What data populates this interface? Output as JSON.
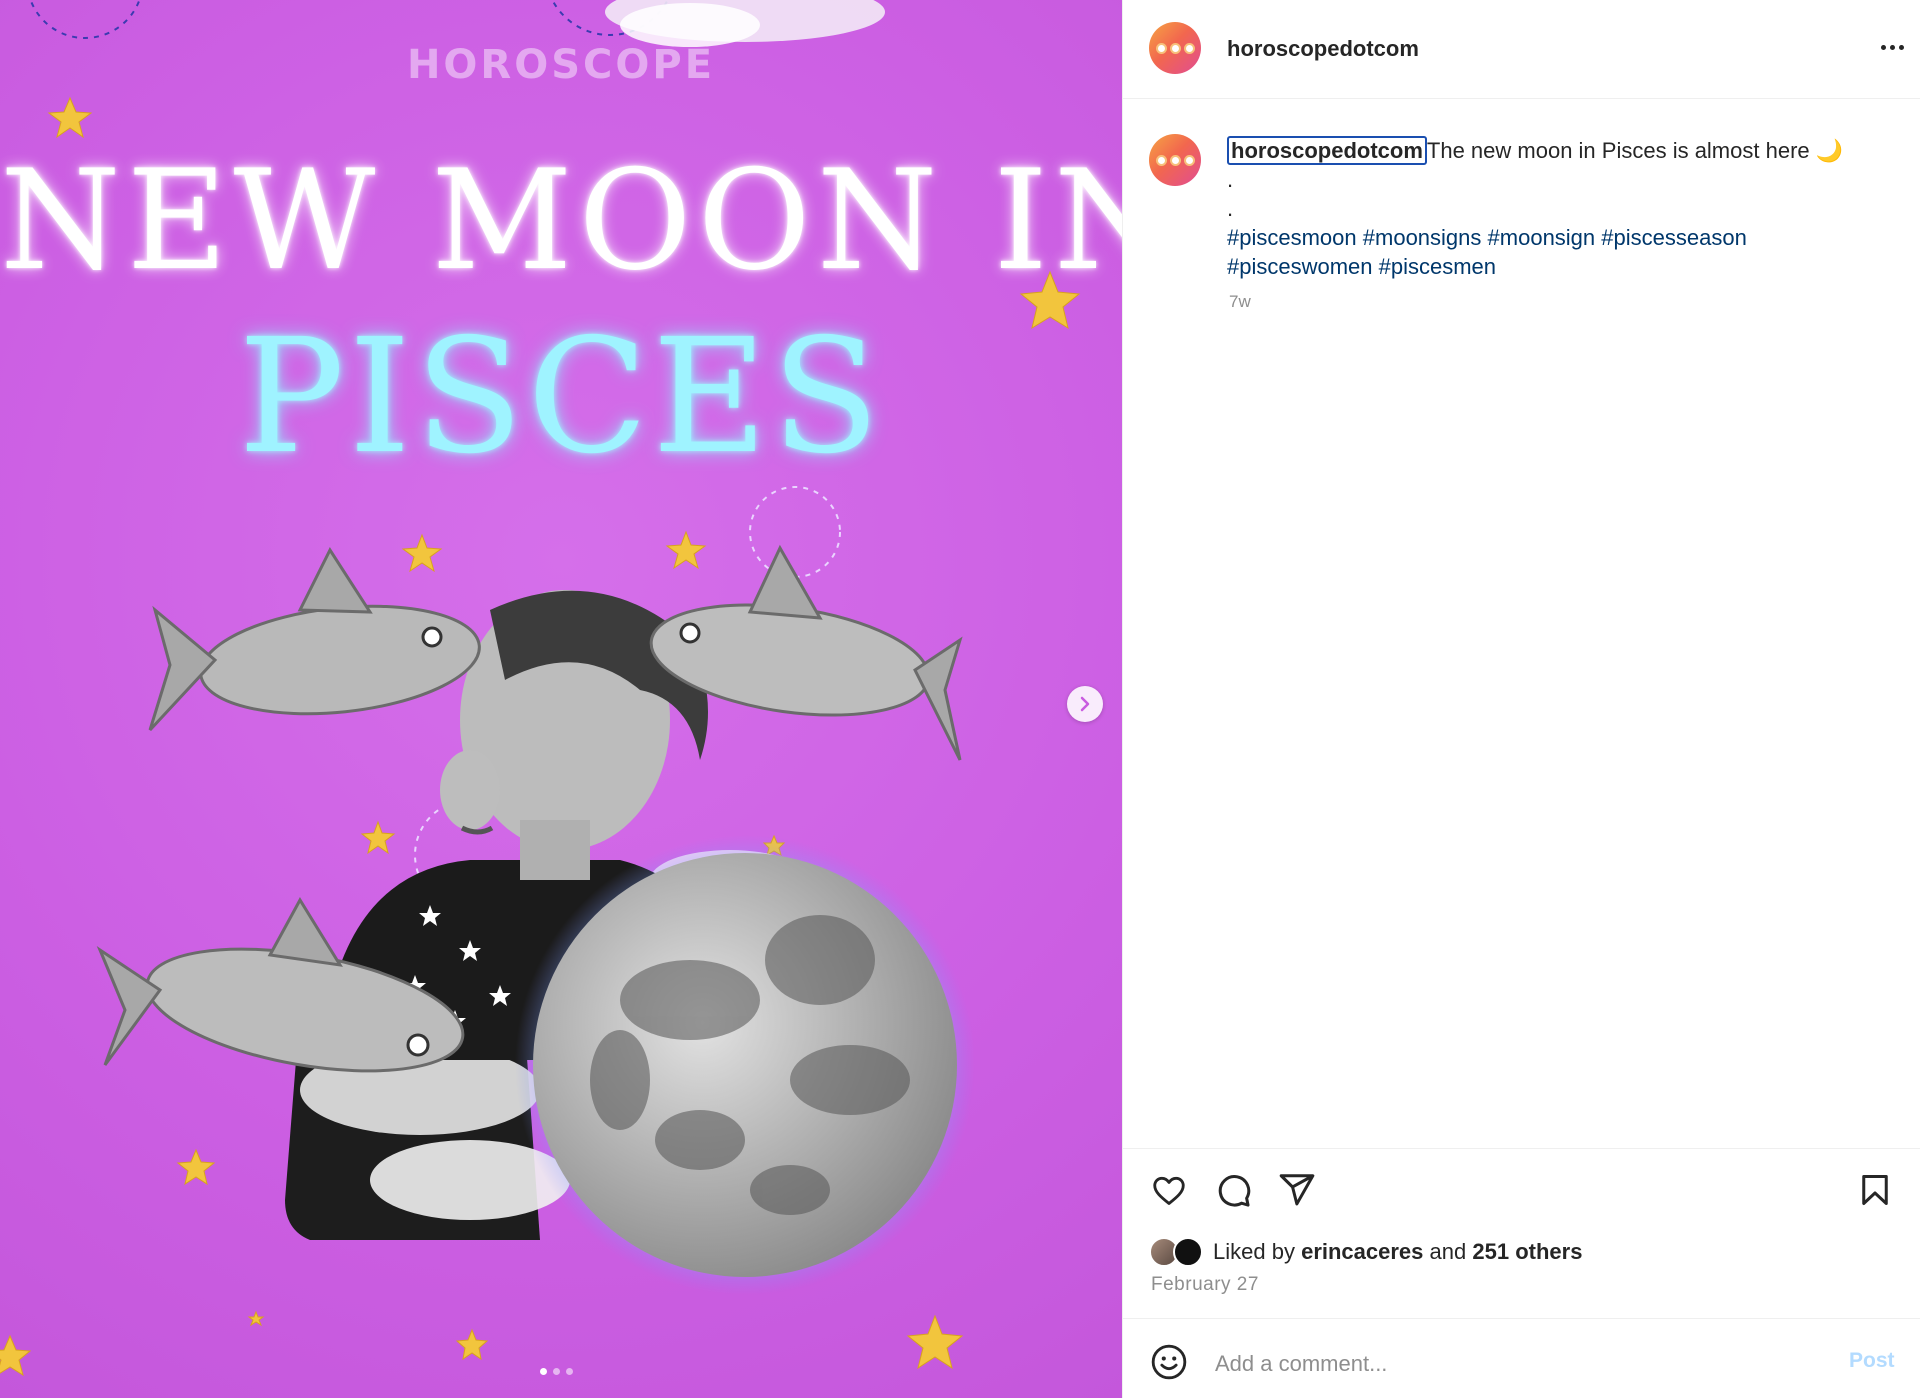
{
  "post": {
    "brand_watermark": "HOROSCOPE",
    "title_line1": "NEW MOON IN",
    "title_line2": "PISCES",
    "carousel": {
      "total": 3,
      "active": 1
    }
  },
  "header": {
    "username": "horoscopedotcom",
    "more_icon": "more-options-icon"
  },
  "caption": {
    "username": "horoscopedotcom",
    "text": "The new moon in Pisces is almost here",
    "emoji": "🌙",
    "dot1": ".",
    "dot2": ".",
    "hashtags_line1": [
      "#piscesmoon",
      "#moonsigns",
      "#moonsign",
      "#piscesseason"
    ],
    "hashtags_line2": [
      "#pisceswomen",
      "#piscesmen"
    ],
    "time_ago": "7w"
  },
  "actions": {
    "icons": [
      "heart-icon",
      "comment-icon",
      "share-icon",
      "bookmark-icon"
    ]
  },
  "likes": {
    "prefix": "Liked by",
    "user": "erincaceres",
    "and": "and",
    "others": "251 others"
  },
  "date": "February 27",
  "comment": {
    "placeholder": "Add a comment...",
    "post_label": "Post"
  },
  "colors": {
    "post_background": "#cf63e6",
    "title_white": "#ffffff",
    "title_cyan": "#9ff3ff",
    "hashtag": "#00376b",
    "post_button_disabled": "#b3dbff"
  }
}
